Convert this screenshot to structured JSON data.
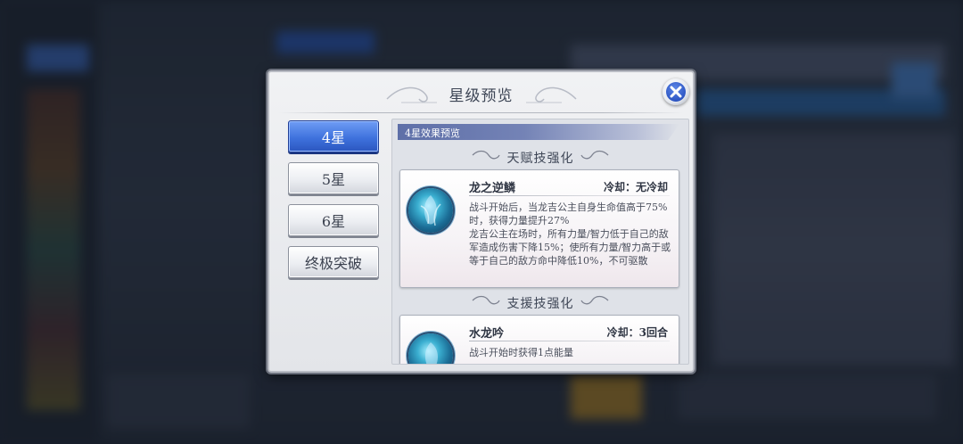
{
  "dialog": {
    "title": "星级预览",
    "close_icon": "close-x-icon"
  },
  "tabs": [
    {
      "label": "4星",
      "active": true
    },
    {
      "label": "5星",
      "active": false
    },
    {
      "label": "6星",
      "active": false
    },
    {
      "label": "终极突破",
      "active": false
    }
  ],
  "panel": {
    "header": "4星效果预览",
    "sections": [
      {
        "title": "天赋技强化",
        "skill": {
          "name": "龙之逆鳞",
          "cooldown": "冷却：无冷却",
          "icon": "dragon-skill-icon",
          "description": "战斗开始后，当龙吉公主自身生命值高于75%时，获得力量提升27%\n龙吉公主在场时，所有力量/智力低于自己的敌军造成伤害下降15%；使所有力量/智力高于或等于自己的敌方命中降低10%，不可驱散"
        }
      },
      {
        "title": "支援技强化",
        "skill": {
          "name": "水龙吟",
          "cooldown": "冷却：3回合",
          "icon": "water-dragon-skill-icon",
          "description": "战斗开始时获得1点能量"
        }
      }
    ]
  }
}
